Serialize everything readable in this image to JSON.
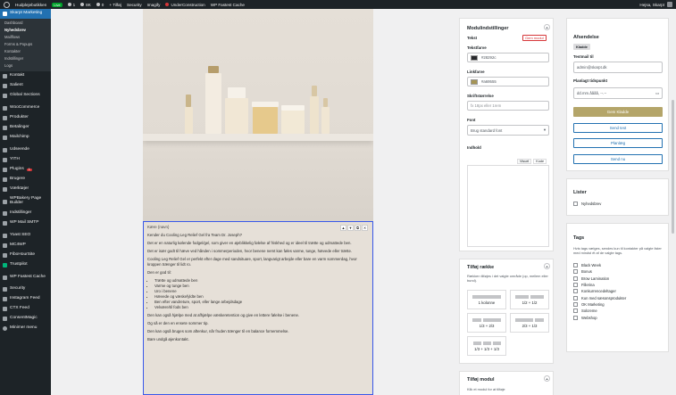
{
  "adminbar": {
    "site": "Hudplejebutikken",
    "live": "Live",
    "updates": "1",
    "comments": "0",
    "counter": "8K",
    "new": "Tilføj",
    "security": "Security",
    "imagify": "Imagify",
    "under": "UnderConstruction",
    "cache": "WP Fastest Cache",
    "greeting": "Hejsa, Skarpt"
  },
  "sidebar": {
    "active": "Skarpt Marketing",
    "sub": [
      "Dashboard",
      "Nyhedsbrev",
      "Mailflows",
      "Forms & Popups",
      "Kontakter",
      "Indstillinger",
      "Logs"
    ],
    "items": [
      "Kontakt",
      "Salient",
      "Global Sections",
      "WooCommerce",
      "Produkter",
      "Betalinger",
      "Mailchimp",
      "Udseende",
      "YITH",
      "Plugins",
      "Brugere",
      "Værktøjer",
      "WPBakery Page Builder",
      "Indstillinger",
      "WP Mail SMTP",
      "Yoast SEO",
      "MC4WP",
      "FiboHourSite",
      "Trustpilot",
      "WP Fastest Cache",
      "Security",
      "Instagram Feed",
      "CTX Feed",
      "ConsentMagic",
      "Minimer menu"
    ],
    "plugins_badge": "1"
  },
  "block": {
    "tag": "Kære {navn}",
    "p1": "Kender du Cooling Leg Relief Gel fra Team Dr. Joseph?",
    "p2": "Det er en naturlig kølende fodgel/gel, som giver en øjeblikkelig følelse af friskhed og er ideel til trætte og udmattede ben.",
    "p3": "Det er især godt til hæve ved hånden i sommerperioden, hvor benene nemt kan føles varme, tunge, hævede eller trætte.",
    "p4": "Cooling Leg Relief Gel er perfekt efter dage med sandsituare, sport, langvarigt arbejde eller bare en varm sommerdag, hvor kroppen trænger til lidt ro.",
    "p5": "Den er god til:",
    "list": [
      "Trætte og udmattede ben",
      "Varme og tunge ben",
      "Uro i benene",
      "Hævede og væskefyldte ben",
      "Ben efter vandreture, sport, eller lange arbejdsdage",
      "Velvære/til fods ben"
    ],
    "p6": "Den kan også hjælpe med at afhjælpe væskeretention og give en lettere følelse i benene.",
    "p7": "Og så er den en ensete sommer tip.",
    "p8": "Den kan også bruges som aftenkur, når fruden trænger til en balance fornemmelse.",
    "p9": "Bare undgå øjenkontakt."
  },
  "module": {
    "title": "Modulindstillinger",
    "text_label": "Tekst",
    "reset": "Gem modul",
    "textcolor_label": "Tekstfarve",
    "textcolor": "#28292c",
    "textcolor_hex": "#28292c",
    "linkcolor_label": "Linkfarve",
    "linkcolor": "#a69555",
    "linkcolor_hex": "#a69555",
    "fontsize_label": "Skriftstørrelse",
    "fontsize_placeholder": "fx 18px eller 1rem",
    "font_label": "Font",
    "font_value": "Brug standard font",
    "content_label": "Indhold",
    "tab_visual": "Visuel",
    "tab_code": "Kode"
  },
  "addrow": {
    "title": "Tilføj række",
    "hint": "Rækken tilføjes i det valgte område (op, mellem eller bund).",
    "options": [
      "1 kolonne",
      "1/2 + 1/2",
      "1/3 + 2/3",
      "2/3 + 1/3",
      "1/3 + 1/3 + 1/3"
    ]
  },
  "addmodule": {
    "title": "Tilføj modul",
    "hint": "Klik et modul for at tilføje"
  },
  "send": {
    "title": "Afsendelse",
    "badge": "Kladde",
    "to_label": "Testmail til",
    "to_value": "admin@skarpt.dk",
    "sched_label": "Planlagt tidspunkt",
    "sched_value": "dd.mm.åååå, --.--",
    "save": "Gem Kladde",
    "test": "Send test",
    "plan": "Planlæg",
    "now": "Send nu"
  },
  "lists": {
    "title": "Lister",
    "items": [
      "Nyhedsbrev"
    ]
  },
  "tags": {
    "title": "Tags",
    "hint": "Hvis tags vælges, sendes kun til kontakter på valgte lister med mindst ét af de valgte tags.",
    "items": [
      "Black Week",
      "Bonus",
      "Brow Lamination",
      "Fillerina",
      "Konkurrencedeltager",
      "Kun med sæsonsprodukter",
      "OK Marketing",
      "Solcreme",
      "Webshop"
    ]
  },
  "colors": {
    "accent": "#b4a569",
    "wp_blue": "#2271b1",
    "sidebar_bg": "#1d2327"
  }
}
